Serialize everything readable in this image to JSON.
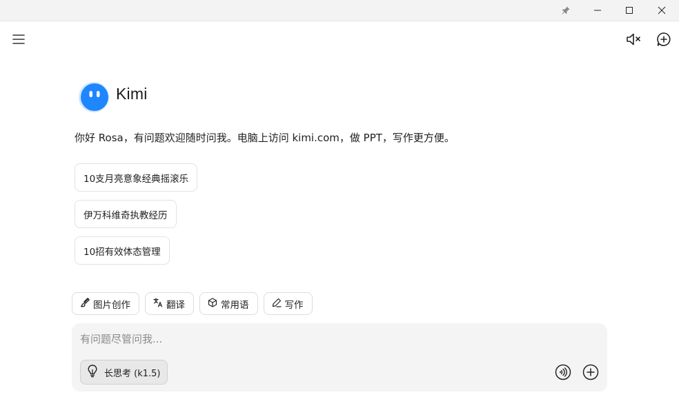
{
  "window": {
    "icons": [
      "pin-icon",
      "minimize-icon",
      "maximize-icon",
      "close-icon"
    ]
  },
  "header": {
    "menu_icon": "hamburger-menu-icon",
    "mute_icon": "speaker-muted-icon",
    "new_chat_icon": "new-chat-icon"
  },
  "brand": {
    "name": "Kimi",
    "accent": "#1e86ff"
  },
  "greeting": "你好 Rosa，有问题欢迎随时问我。电脑上访问 kimi.com，做 PPT，写作更方便。",
  "suggestions": [
    "10支月亮意象经典摇滚乐",
    "伊万科维奇执教经历",
    "10招有效体态管理"
  ],
  "tools": [
    {
      "label": "图片创作",
      "icon": "brush-icon"
    },
    {
      "label": "翻译",
      "icon": "translate-icon"
    },
    {
      "label": "常用语",
      "icon": "cube-icon"
    },
    {
      "label": "写作",
      "icon": "pen-icon"
    }
  ],
  "composer": {
    "placeholder": "有问题尽管问我...",
    "value": "",
    "think_label": "长思考 (k1.5)",
    "think_icon": "lightbulb-icon",
    "voice_icon": "voice-call-icon",
    "attach_icon": "add-icon"
  }
}
